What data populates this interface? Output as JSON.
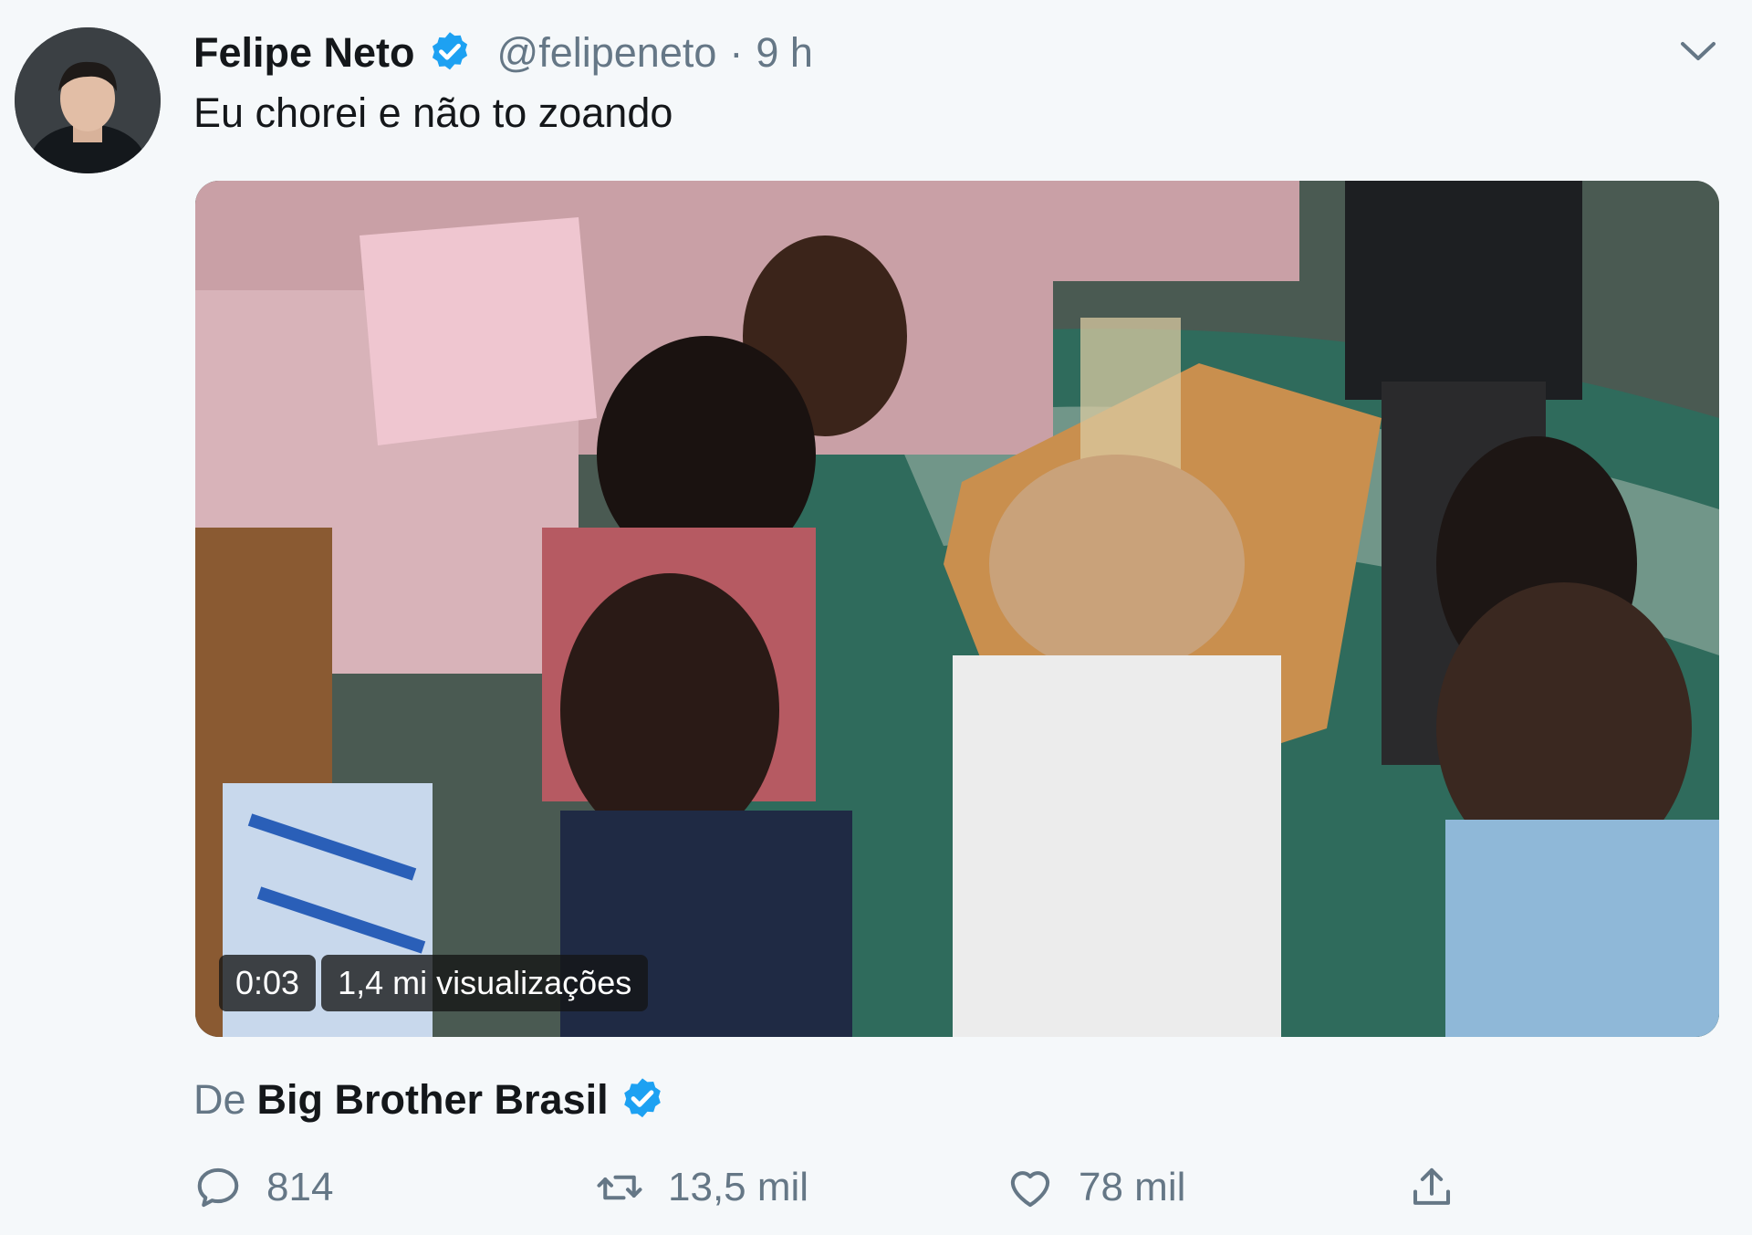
{
  "tweet": {
    "display_name": "Felipe Neto",
    "handle": "@felipeneto",
    "separator": "·",
    "time": "9 h",
    "text": "Eu chorei e não to zoando"
  },
  "media": {
    "duration": "0:03",
    "views": "1,4 mi visualizações"
  },
  "attribution": {
    "prefix": "De",
    "source": "Big Brother Brasil"
  },
  "actions": {
    "replies": "814",
    "retweets": "13,5 mil",
    "likes": "78 mil"
  },
  "colors": {
    "background": "#f5f8fa",
    "verified": "#1da1f2",
    "secondary_text": "#657786",
    "primary_text": "#14171a"
  },
  "icons": {
    "verified": "verified-badge-icon",
    "caret": "chevron-down-icon",
    "reply": "reply-icon",
    "retweet": "retweet-icon",
    "like": "heart-icon",
    "share": "share-icon"
  }
}
